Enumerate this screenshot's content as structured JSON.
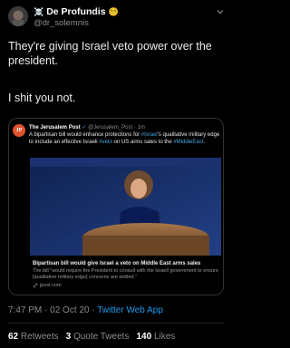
{
  "author": {
    "name": "De Profundis",
    "skull_emoji": "☠️",
    "badge_emoji": "😵‍💫",
    "handle": "@dr_solemnis"
  },
  "tweet": {
    "line1": "They're giving Israel veto power over the president.",
    "line2": "I shit you not."
  },
  "quoted": {
    "logo_text": "JP",
    "author": "The Jerusalem Post",
    "verified_icon": "✓",
    "handle": "@Jerusalem_Post",
    "age": "1m",
    "body_part1": "A bipartisan bill would enhance protections for ",
    "hashtag1": "#Israel",
    "body_part2": "'s qualitative military edge to include an effective Israeli ",
    "hashtag2": "#veto",
    "body_part3": " on US arms sales to the ",
    "hashtag3": "#MiddleEast",
    "body_part4": ".",
    "link_title": "Bipartisan bill would give Israel a veto on Middle East arms sales",
    "link_desc": "The bill \"would require the President to consult with the Israeli government to ensure [qualitative military edge] concerns are settled.\"",
    "link_domain": "jpost.com"
  },
  "meta": {
    "time": "7:47 PM",
    "date": "02 Oct 20",
    "separator": "·",
    "source": "Twitter Web App"
  },
  "stats": {
    "retweets": "62",
    "retweets_label": "Retweets",
    "quotes": "3",
    "quotes_label": "Quote Tweets",
    "likes": "140",
    "likes_label": "Likes"
  },
  "colors": {
    "background": "#000000",
    "link_blue": "#1d9bf0",
    "jp_orange": "#e0522e"
  }
}
